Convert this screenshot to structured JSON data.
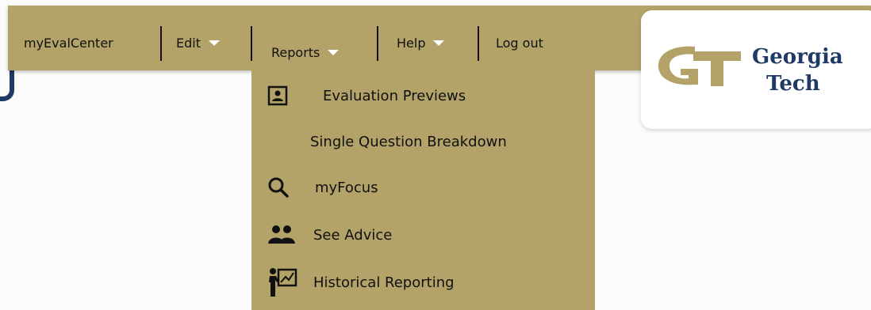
{
  "nav": {
    "items": [
      {
        "label": "myEvalCenter"
      },
      {
        "label": "Edit"
      },
      {
        "label": "Reports"
      },
      {
        "label": "Help"
      },
      {
        "label": "Log out"
      }
    ]
  },
  "dropdown": {
    "items": [
      {
        "label": "Evaluation Previews",
        "icon": "person-card-icon"
      },
      {
        "label": "Single Question Breakdown",
        "icon": ""
      },
      {
        "label": "myFocus",
        "icon": "search-icon"
      },
      {
        "label": "See Advice",
        "icon": "people-icon"
      },
      {
        "label": "Historical Reporting",
        "icon": "presenter-chart-icon"
      }
    ]
  },
  "logo": {
    "line1": "Georgia",
    "line2": "Tech",
    "mark": "GT"
  },
  "colors": {
    "gold": "#b3a369",
    "navy": "#1f3a66"
  }
}
